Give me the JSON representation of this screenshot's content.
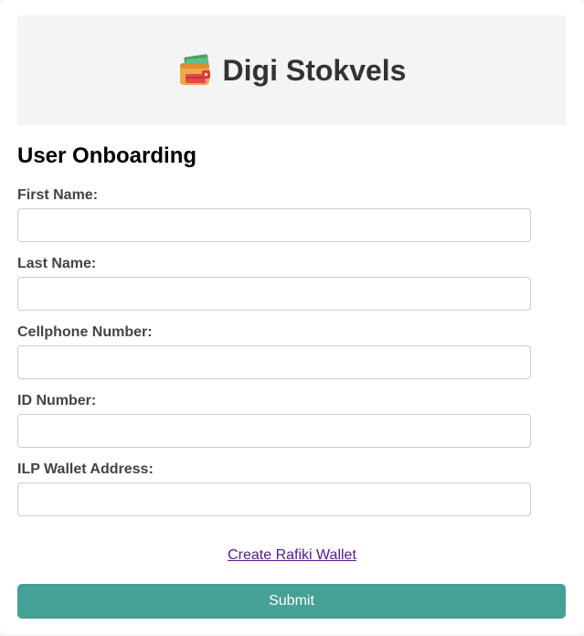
{
  "header": {
    "app_title": "Digi Stokvels",
    "logo_icon": "wallet-icon"
  },
  "form": {
    "title": "User Onboarding",
    "fields": [
      {
        "label": "First Name:",
        "value": "",
        "placeholder": ""
      },
      {
        "label": "Last Name:",
        "value": "",
        "placeholder": ""
      },
      {
        "label": "Cellphone Number:",
        "value": "",
        "placeholder": ""
      },
      {
        "label": "ID Number:",
        "value": "",
        "placeholder": ""
      },
      {
        "label": "ILP Wallet Address:",
        "value": "",
        "placeholder": ""
      }
    ],
    "wallet_link_label": "Create Rafiki Wallet",
    "submit_label": "Submit"
  },
  "colors": {
    "accent": "#45a095",
    "header_bg": "#f4f4f4",
    "link": "#551a8b"
  }
}
